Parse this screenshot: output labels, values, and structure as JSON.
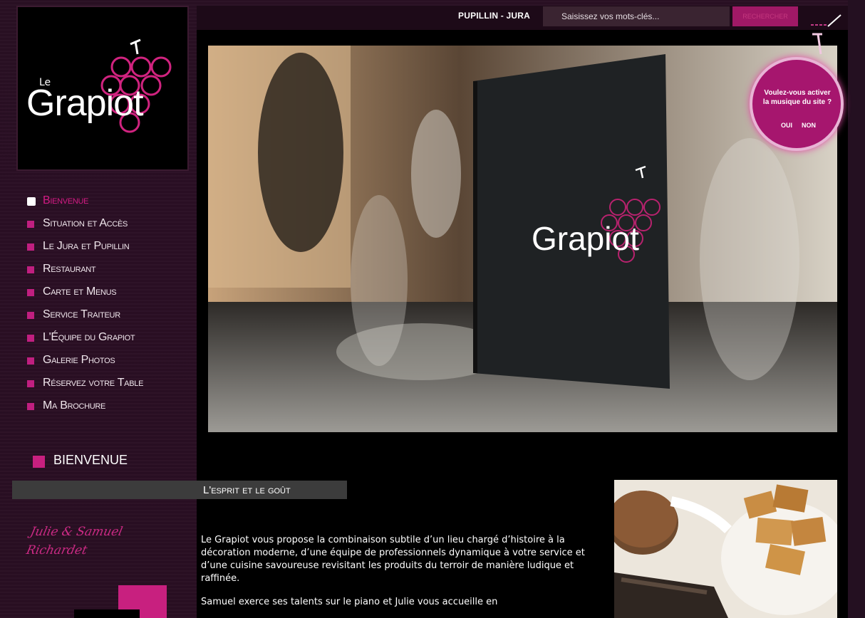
{
  "header": {
    "location": "PUPILLIN - JURA",
    "search_placeholder": "Saisissez vos mots-clés...",
    "search_button": "RECHERCHER"
  },
  "logo": {
    "prefix": "Le",
    "name": "Grapiot"
  },
  "music_popup": {
    "question_line1": "Voulez-vous activer",
    "question_line2": "la musique du site ?",
    "yes": "OUI",
    "no": "NON"
  },
  "nav": {
    "items": [
      {
        "label": "Bienvenue",
        "active": true
      },
      {
        "label": "Situation et Accès",
        "active": false
      },
      {
        "label": "Le Jura et Pupillin",
        "active": false
      },
      {
        "label": "Restaurant",
        "active": false
      },
      {
        "label": "Carte et Menus",
        "active": false
      },
      {
        "label": "Service Traiteur",
        "active": false
      },
      {
        "label": "L'Équipe du Grapiot",
        "active": false
      },
      {
        "label": "Galerie Photos",
        "active": false
      },
      {
        "label": "Réservez votre Table",
        "active": false
      },
      {
        "label": "Ma Brochure",
        "active": false
      }
    ]
  },
  "section": {
    "title": "BIENVENUE",
    "subtitle": "L'esprit et le goût"
  },
  "signature": {
    "line1": "Julie & Samuel",
    "line2": "Richardet"
  },
  "intro": {
    "paragraph1": "Le Grapiot vous propose la combinaison subtile d’un lieu chargé d’histoire à la décoration moderne, d’une équipe de professionnels dynamique à votre service et d’une cuisine savoureuse revisitant les produits du terroir de manière ludique et raffinée.",
    "paragraph2": "Samuel exerce ses talents sur le piano et Julie vous accueille en"
  },
  "colors": {
    "brand_magenta": "#c8207f",
    "background": "#2a0f23",
    "panel": "#000000"
  }
}
